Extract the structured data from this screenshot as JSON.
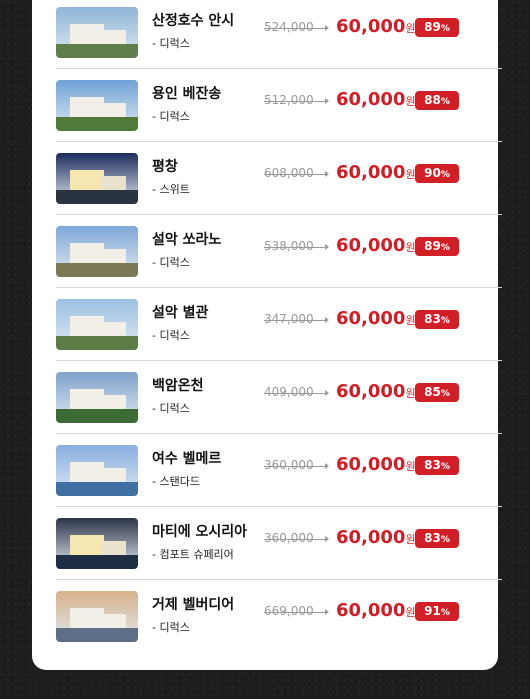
{
  "currency_unit": "원",
  "hotels": [
    {
      "name": "산정호수 안시",
      "room": "- 디럭스",
      "original_price": "524,000",
      "price": "60,000",
      "discount": "89",
      "theme": [
        "#8fb6d8",
        "#5e7f4a"
      ]
    },
    {
      "name": "용인 베잔송",
      "room": "- 디럭스",
      "original_price": "512,000",
      "price": "60,000",
      "discount": "88",
      "theme": [
        "#6fa1d6",
        "#4f7a3a"
      ]
    },
    {
      "name": "평창",
      "room": "- 스위트",
      "original_price": "608,000",
      "price": "60,000",
      "discount": "90",
      "theme": [
        "#1d2c5c",
        "#2a3440"
      ]
    },
    {
      "name": "설악 쏘라노",
      "room": "- 디럭스",
      "original_price": "538,000",
      "price": "60,000",
      "discount": "89",
      "theme": [
        "#7fa7d8",
        "#7c7a55"
      ]
    },
    {
      "name": "설악 별관",
      "room": "- 디럭스",
      "original_price": "347,000",
      "price": "60,000",
      "discount": "83",
      "theme": [
        "#9cc0e3",
        "#5c7d45"
      ]
    },
    {
      "name": "백암온천",
      "room": "- 디럭스",
      "original_price": "409,000",
      "price": "60,000",
      "discount": "85",
      "theme": [
        "#7ea1cc",
        "#3d6b35"
      ]
    },
    {
      "name": "여수 벨메르",
      "room": "- 스탠다드",
      "original_price": "360,000",
      "price": "60,000",
      "discount": "83",
      "theme": [
        "#87aee0",
        "#3f6fa3"
      ]
    },
    {
      "name": "마티에 오시리아",
      "room": "- 컴포트 슈페리어",
      "original_price": "360,000",
      "price": "60,000",
      "discount": "83",
      "theme": [
        "#2c3448",
        "#1f2d45"
      ]
    },
    {
      "name": "거제 벨버디어",
      "room": "- 디럭스",
      "original_price": "669,000",
      "price": "60,000",
      "discount": "91",
      "theme": [
        "#d7b18a",
        "#5d6f86"
      ]
    }
  ]
}
